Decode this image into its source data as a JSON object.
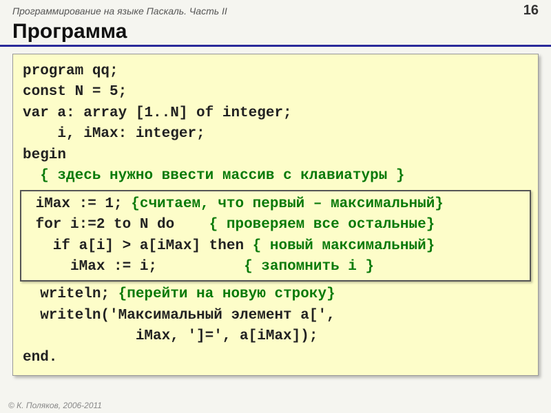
{
  "header": {
    "course": "Программирование на языке Паскаль. Часть II",
    "page": "16"
  },
  "title": "Программа",
  "code": {
    "l1": "program qq;",
    "l2": "const N = 5;",
    "l3": "var a: array [1..N] of integer;",
    "l4": "    i, iMax: integer;",
    "l5": "begin",
    "l6_pre": "  ",
    "l6_comment": "{ здесь нужно ввести массив с клавиатуры }",
    "hl1_code": " iMax := 1; ",
    "hl1_comment": "{считаем, что первый – максимальный}",
    "hl2_code": " for i:=2 to N do    ",
    "hl2_comment": "{ проверяем все остальные}",
    "hl3_code": "   if a[i] > a[iMax] then ",
    "hl3_comment": "{ новый максимальный}",
    "hl4_code": "     iMax := i;          ",
    "hl4_comment": "{ запомнить i }",
    "l7_code": "  writeln; ",
    "l7_comment": "{перейти на новую строку}",
    "l8": "  writeln('Максимальный элемент a[',",
    "l9": "             iMax, ']=', a[iMax]);",
    "l10": "end."
  },
  "footer": "© К. Поляков, 2006-2011"
}
